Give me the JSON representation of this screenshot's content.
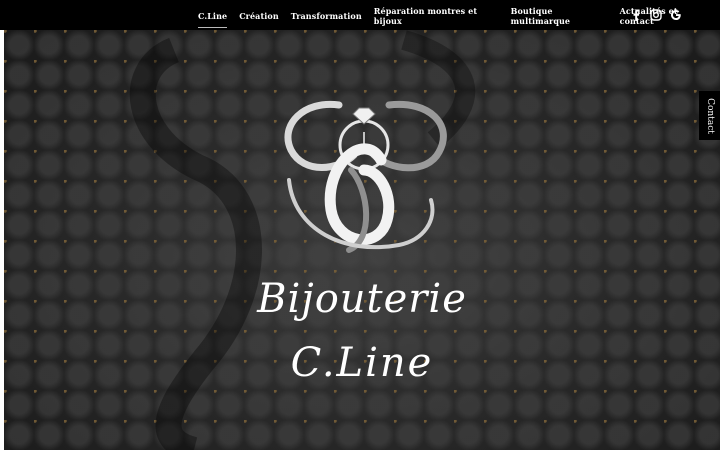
{
  "nav": {
    "items": [
      {
        "label": "C.Line",
        "active": true
      },
      {
        "label": "Création"
      },
      {
        "label": "Transformation"
      },
      {
        "label": "Réparation montres et bijoux"
      },
      {
        "label": "Boutique multimarque"
      },
      {
        "label": "Actualités et contact"
      }
    ]
  },
  "social": {
    "icons": [
      "facebook-icon",
      "instagram-icon",
      "google-icon"
    ]
  },
  "hero": {
    "brand_line1": "Bijouterie",
    "brand_line2": "C.Line",
    "logo": "ring-watch-monogram-logo"
  },
  "contact_tab": {
    "label": "Contact"
  },
  "colors": {
    "topbar": "#000000",
    "text": "#ffffff",
    "background": "#2a2a2a"
  }
}
